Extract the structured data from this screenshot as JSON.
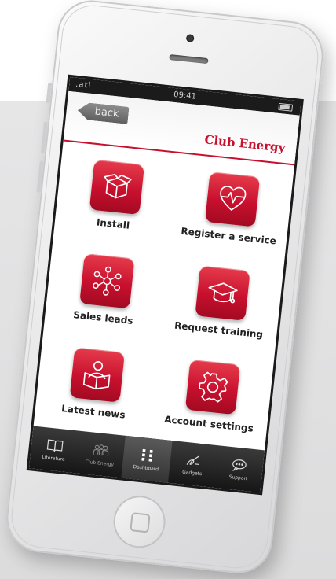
{
  "status_bar": {
    "signal": ".atl",
    "time": "09:41"
  },
  "nav": {
    "back_label": "back",
    "title": "Club Energy"
  },
  "tiles": [
    {
      "label": "Install",
      "icon": "box-icon"
    },
    {
      "label": "Register a service",
      "icon": "heart-pulse-icon"
    },
    {
      "label": "Sales leads",
      "icon": "network-icon"
    },
    {
      "label": "Request training",
      "icon": "graduation-cap-icon"
    },
    {
      "label": "Latest news",
      "icon": "reader-icon"
    },
    {
      "label": "Account settings",
      "icon": "gear-icon"
    }
  ],
  "tabs": [
    {
      "label": "Literature",
      "icon": "book-icon"
    },
    {
      "label": "Club Energy",
      "icon": "people-icon"
    },
    {
      "label": "Dashboard",
      "icon": "grid-icon",
      "active": true
    },
    {
      "label": "Gadgets",
      "icon": "pen-icon"
    },
    {
      "label": "Support",
      "icon": "chat-icon"
    }
  ],
  "colors": {
    "brand_red": "#c8102e",
    "tab_bar": "#1b1b1b"
  }
}
